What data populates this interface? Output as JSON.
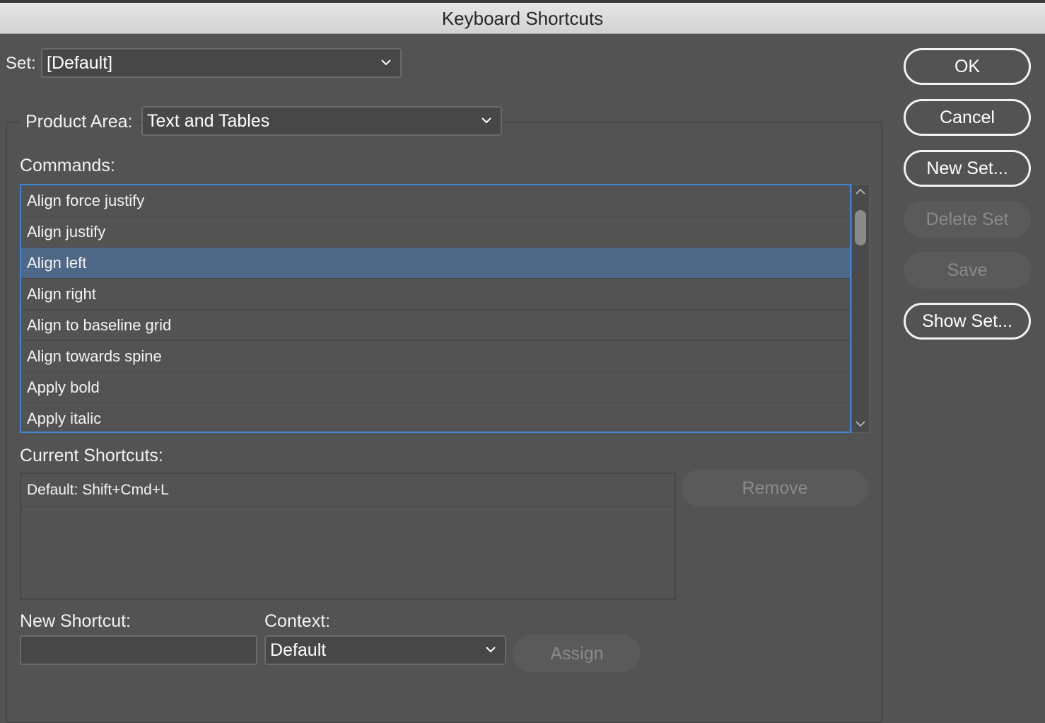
{
  "window": {
    "title": "Keyboard Shortcuts"
  },
  "set": {
    "label": "Set:",
    "value": "[Default]"
  },
  "product_area": {
    "label": "Product Area:",
    "value": "Text and Tables"
  },
  "commands": {
    "label": "Commands:",
    "items": [
      "Align force justify",
      "Align justify",
      "Align left",
      "Align right",
      "Align to baseline grid",
      "Align towards spine",
      "Apply bold",
      "Apply italic"
    ],
    "selected": "Align left"
  },
  "current_shortcuts": {
    "label": "Current Shortcuts:",
    "items": [
      "Default: Shift+Cmd+L"
    ],
    "remove_label": "Remove"
  },
  "new_shortcut": {
    "label": "New Shortcut:",
    "value": ""
  },
  "context": {
    "label": "Context:",
    "value": "Default"
  },
  "assign_label": "Assign",
  "buttons": {
    "ok": "OK",
    "cancel": "Cancel",
    "new_set": "New Set...",
    "delete_set": "Delete Set",
    "save": "Save",
    "show_set": "Show Set..."
  },
  "colors": {
    "background": "#535353",
    "selection": "#4e6887",
    "focus_border": "#3f86d9",
    "disabled_text": "#8a8a8a"
  }
}
